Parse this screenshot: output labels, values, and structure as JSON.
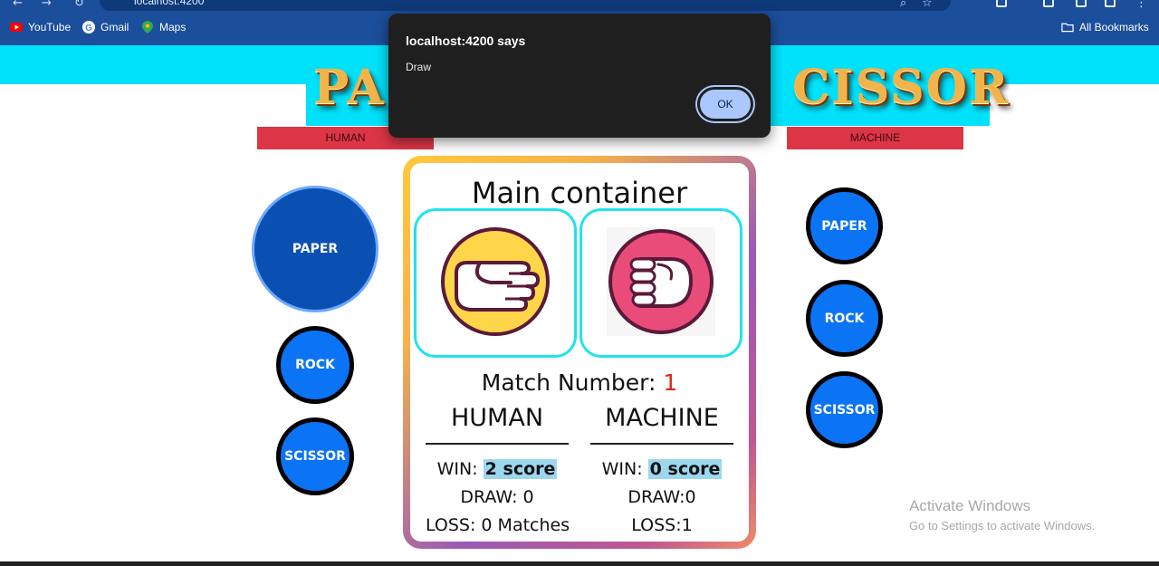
{
  "browser": {
    "address": "localhost:4200",
    "bookmarks": [
      {
        "label": "YouTube",
        "icon": "youtube-icon"
      },
      {
        "label": "Gmail",
        "icon": "google-icon"
      },
      {
        "label": "Maps",
        "icon": "maps-icon"
      }
    ],
    "all_bookmarks": "All Bookmarks"
  },
  "banner": {
    "left_text": "PA",
    "right_text": "CISSOR"
  },
  "labels": {
    "human": "HUMAN",
    "machine": "MACHINE"
  },
  "human_choices": [
    {
      "label": "PAPER",
      "selected": true
    },
    {
      "label": "ROCK",
      "selected": false
    },
    {
      "label": "SCISSOR",
      "selected": false
    }
  ],
  "machine_choices": [
    {
      "label": "PAPER"
    },
    {
      "label": "ROCK"
    },
    {
      "label": "SCISSOR"
    }
  ],
  "main": {
    "title": "Main container",
    "human_hand": "paper-hand-icon",
    "machine_hand": "rock-fist-icon",
    "match_label": "Match Number:",
    "match_number": "1",
    "human": {
      "heading": "HUMAN",
      "win_label": "WIN:",
      "win_value": "2 score",
      "draw": "DRAW: 0",
      "loss": "LOSS: 0 Matches"
    },
    "machine": {
      "heading": "MACHINE",
      "win_label": "WIN:",
      "win_value": "0 score",
      "draw": "DRAW:0",
      "loss": "LOSS:1"
    }
  },
  "dialog": {
    "title": "localhost:4200 says",
    "message": "Draw",
    "ok_label": "OK"
  },
  "watermark": {
    "line1": "Activate Windows",
    "line2": "Go to Settings to activate Windows."
  },
  "colors": {
    "cyan": "#00e1fb",
    "label_red": "#dc3545",
    "button_blue": "#0b74f5",
    "highlight": "#9cd7ee"
  }
}
